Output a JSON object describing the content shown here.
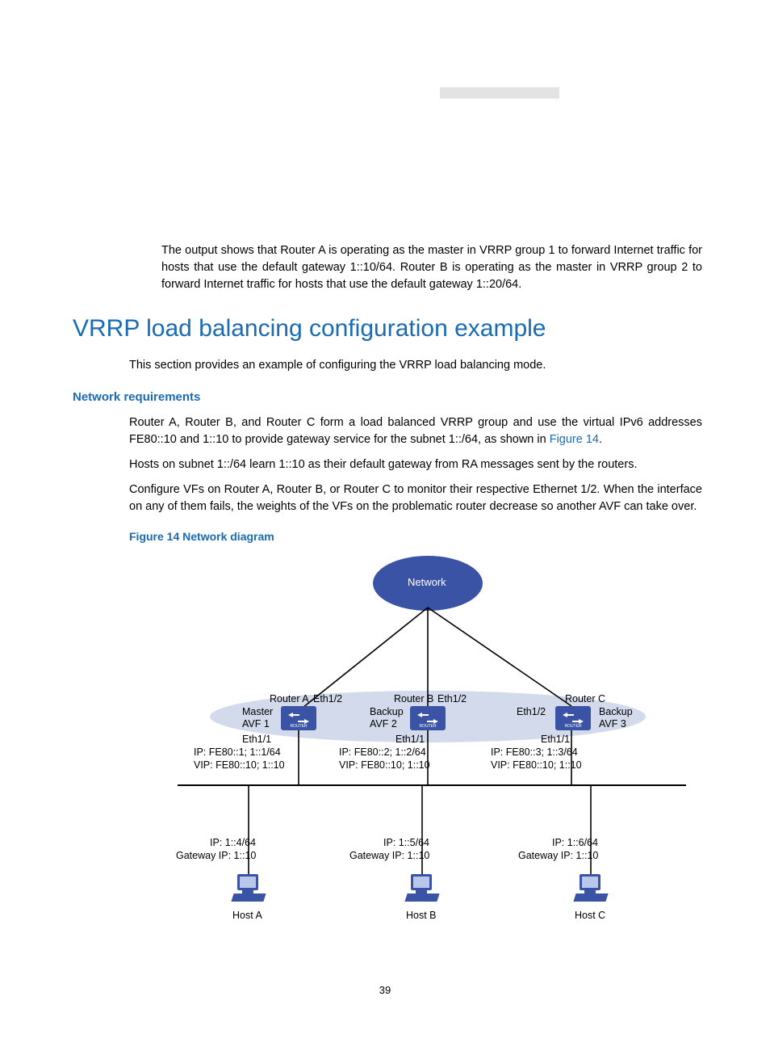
{
  "intro_para": "The output shows that Router A is operating as the master in VRRP group 1 to forward Internet traffic for hosts that use the default gateway 1::10/64. Router B is operating as the master in VRRP group 2 to forward Internet traffic for hosts that use the default gateway 1::20/64.",
  "heading": "VRRP load balancing configuration example",
  "heading_para": "This section provides an example of configuring the VRRP load balancing mode.",
  "network_req_title": "Network requirements",
  "req_para1_a": "Router A, Router B, and Router C form a load balanced VRRP group and use the virtual IPv6 addresses FE80::10 and 1::10 to provide gateway service for the subnet 1::/64, as shown in ",
  "req_para1_link": "Figure 14",
  "req_para1_b": ".",
  "req_para2": "Hosts on subnet 1::/64 learn 1::10 as their default gateway from RA messages sent by the routers.",
  "req_para3": "Configure VFs on Router A, Router B, or Router C to monitor their respective Ethernet 1/2. When the interface on any of them fails, the weights of the VFs on the problematic router decrease so another AVF can take over.",
  "figure_caption": "Figure 14 Network diagram",
  "page_number": "39",
  "diagram": {
    "network_label": "Network",
    "routerA": {
      "name": "Router A",
      "eth_up": "Eth1/2",
      "role": "Master",
      "avf": "AVF 1",
      "eth_dn": "Eth1/1",
      "ip": "IP: FE80::1; 1::1/64",
      "vip": "VIP: FE80::10; 1::10"
    },
    "routerB": {
      "name": "Router B",
      "eth_up": "Eth1/2",
      "role": "Backup",
      "avf": "AVF 2",
      "eth_dn": "Eth1/1",
      "ip": "IP: FE80::2; 1::2/64",
      "vip": "VIP: FE80::10; 1::10"
    },
    "routerC": {
      "name": "Router C",
      "eth_up": "Eth1/2",
      "role": "Backup",
      "avf": "AVF 3",
      "eth_dn": "Eth1/1",
      "ip": "IP: FE80::3; 1::3/64",
      "vip": "VIP: FE80::10; 1::10"
    },
    "hostA": {
      "name": "Host A",
      "ip": "IP: 1::4/64",
      "gw": "Gateway IP: 1::10"
    },
    "hostB": {
      "name": "Host B",
      "ip": "IP: 1::5/64",
      "gw": "Gateway IP: 1::10"
    },
    "hostC": {
      "name": "Host C",
      "ip": "IP: 1::6/64",
      "gw": "Gateway IP: 1::10"
    }
  }
}
